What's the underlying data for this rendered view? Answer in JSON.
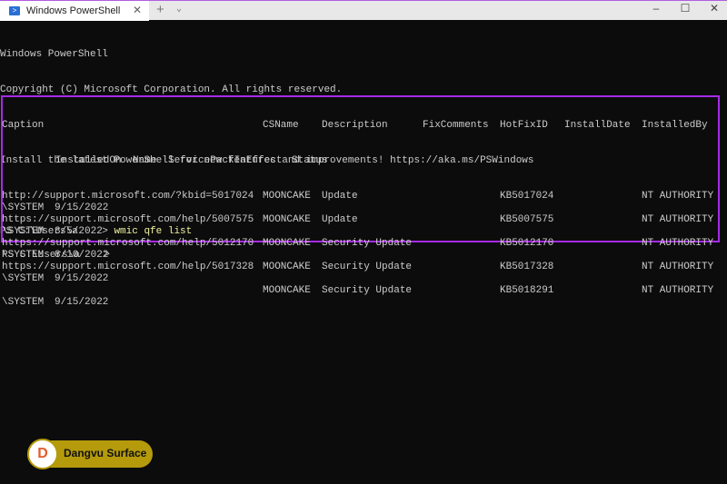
{
  "window": {
    "tab_title": "Windows PowerShell",
    "new_tab": "+",
    "dropdown": "⌄",
    "minimize": "–",
    "maximize": "☐",
    "close": "✕",
    "tab_close": "✕"
  },
  "terminal": {
    "lines": [
      "Windows PowerShell",
      "Copyright (C) Microsoft Corporation. All rights reserved.",
      "",
      "Install the latest PowerShell for new features and improvements! https://aka.ms/PSWindows",
      ""
    ],
    "prompt": "PS C:\\Users\\a",
    "prompt_arrow": "    > ",
    "command": "wmic qfe list",
    "final_prompt": "PS C:\\Users\\a    >"
  },
  "table": {
    "headers": [
      "Caption",
      "CSName",
      "Description",
      "FixComments",
      "HotFixID",
      "InstallDate",
      "InstalledBy"
    ],
    "headers2": [
      "InstalledOn",
      "Name",
      "ServicePackInEffect",
      "Status"
    ],
    "rows": [
      {
        "caption": "http://support.microsoft.com/?kbid=5017024",
        "csname": "MOONCAKE",
        "description": "Update",
        "hotfix": "KB5017024",
        "installed_by": "NT AUTHORITY",
        "installed_by_cont": "\\SYSTEM",
        "installed_on": "9/15/2022"
      },
      {
        "caption": "https://support.microsoft.com/help/5007575",
        "csname": "MOONCAKE",
        "description": "Update",
        "hotfix": "KB5007575",
        "installed_by": "NT AUTHORITY",
        "installed_by_cont": "\\SYSTEM",
        "installed_on": "3/5/2022"
      },
      {
        "caption": "https://support.microsoft.com/help/5012170",
        "csname": "MOONCAKE",
        "description": "Security Update",
        "hotfix": "KB5012170",
        "installed_by": "NT AUTHORITY",
        "installed_by_cont": "\\SYSTEM",
        "installed_on": "8/10/2022"
      },
      {
        "caption": "https://support.microsoft.com/help/5017328",
        "csname": "MOONCAKE",
        "description": "Security Update",
        "hotfix": "KB5017328",
        "installed_by": "NT AUTHORITY",
        "installed_by_cont": "\\SYSTEM",
        "installed_on": "9/15/2022"
      },
      {
        "caption": "",
        "csname": "MOONCAKE",
        "description": "Security Update",
        "hotfix": "KB5018291",
        "installed_by": "NT AUTHORITY",
        "installed_by_cont": "\\SYSTEM",
        "installed_on": "9/15/2022"
      }
    ]
  },
  "watermark": {
    "brand": "Dangvu Surface",
    "logo_letter": "D"
  }
}
